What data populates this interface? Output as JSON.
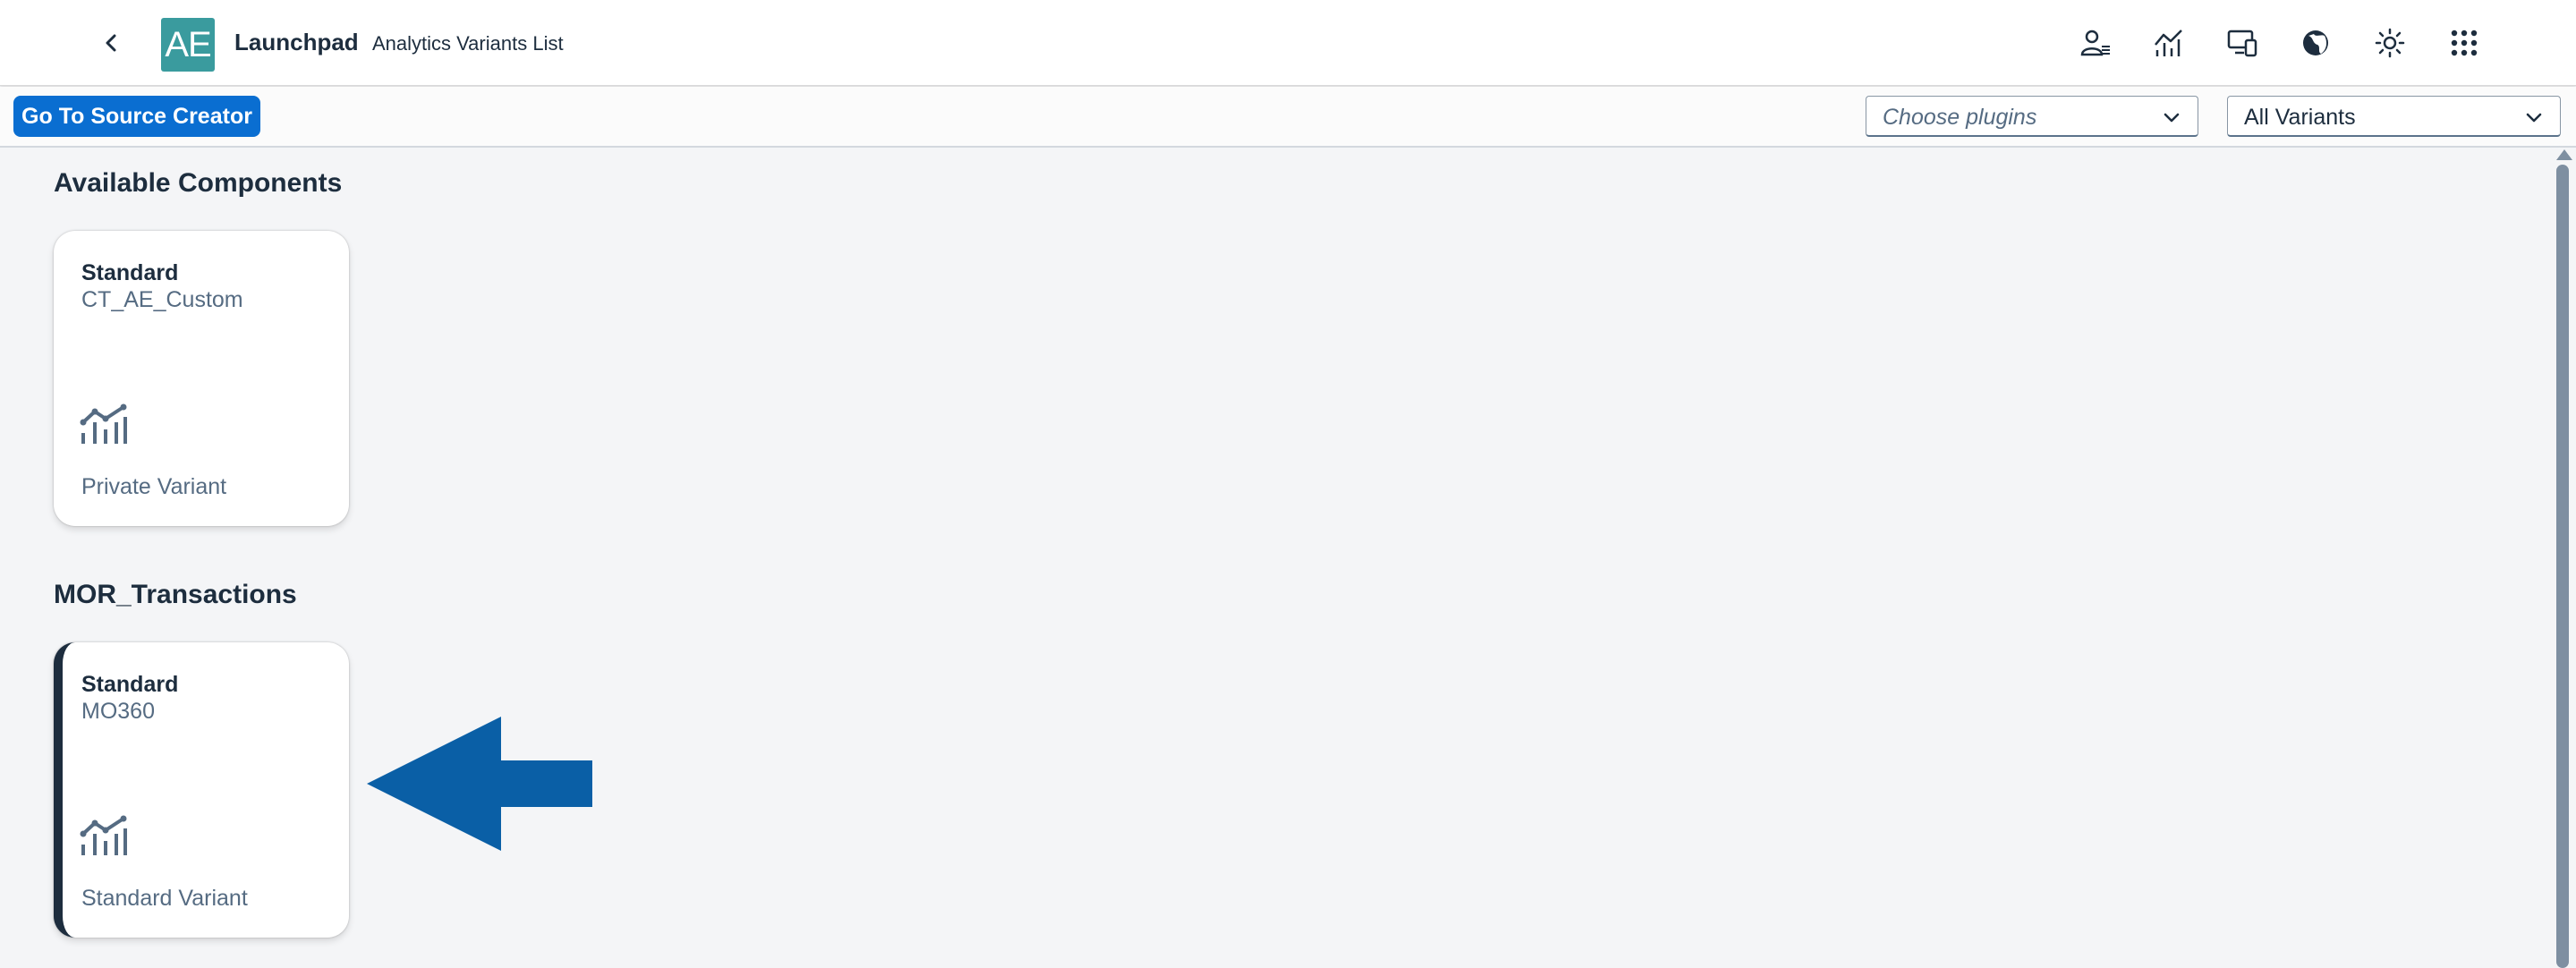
{
  "shell": {
    "logo_text": "AE",
    "title": "Launchpad",
    "subtitle": "Analytics Variants List",
    "icons": [
      "user-settings-icon",
      "analytics-icon",
      "devices-icon",
      "globe-icon",
      "theme-sun-icon",
      "app-grid-icon"
    ]
  },
  "toolbar": {
    "source_button": "Go To Source Creator",
    "plugins_placeholder": "Choose plugins",
    "variants_value": "All Variants"
  },
  "sections": [
    {
      "title": "Available Components",
      "cards": [
        {
          "title": "Standard",
          "subtitle": "CT_AE_Custom",
          "icon": "analytics-icon",
          "footer": "Private Variant",
          "selected": false
        }
      ]
    },
    {
      "title": "MOR_Transactions",
      "cards": [
        {
          "title": "Standard",
          "subtitle": "MO360",
          "icon": "analytics-icon",
          "footer": "Standard Variant",
          "selected": true
        }
      ]
    }
  ],
  "colors": {
    "brand": "#0a6ed1",
    "logo": "#3a9b9e",
    "arrow": "#0a5fa6",
    "text": "#1d2d3e",
    "muted": "#556b82"
  }
}
